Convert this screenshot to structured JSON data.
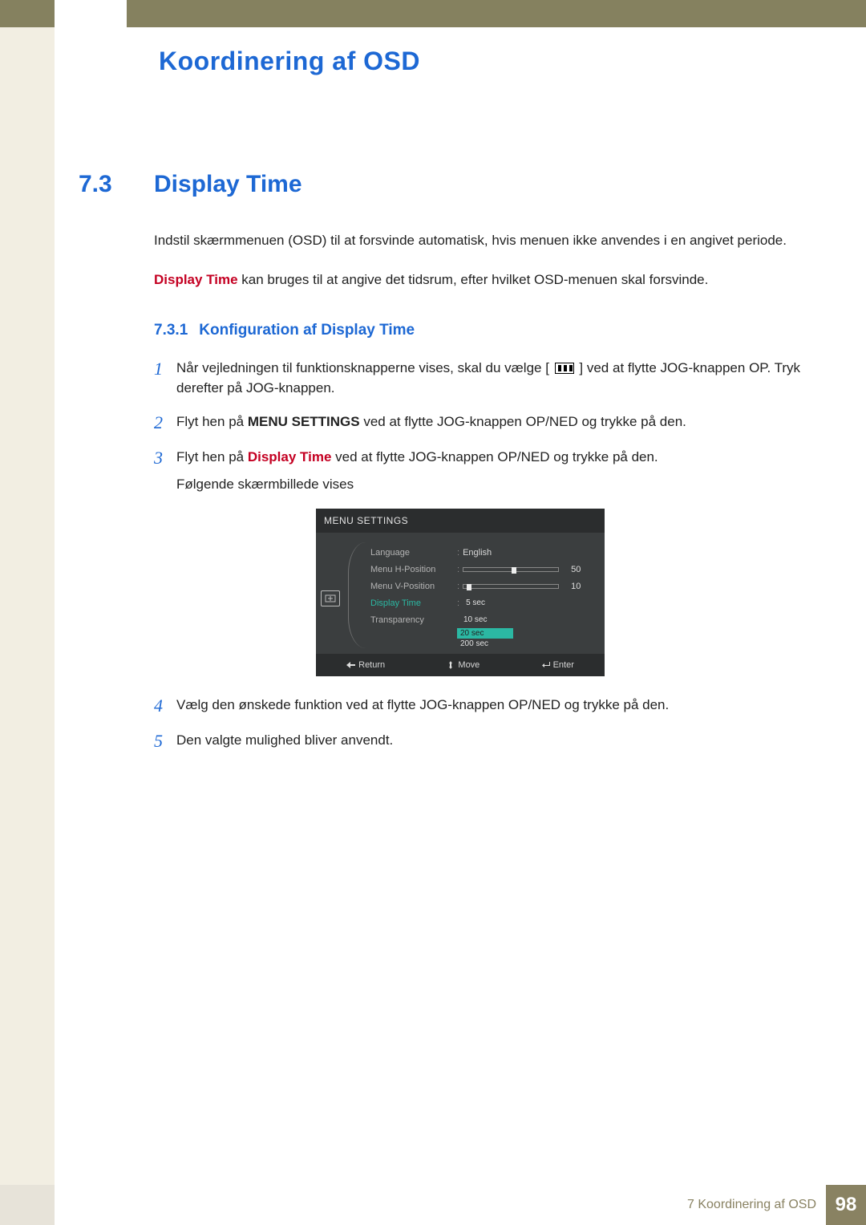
{
  "header": {
    "chapter_title": "Koordinering af OSD"
  },
  "section": {
    "number": "7.3",
    "title": "Display Time"
  },
  "intro": {
    "p1": "Indstil skærmmenuen (OSD) til at forsvinde automatisk, hvis menuen ikke anvendes i en angivet periode.",
    "p2_red": "Display Time",
    "p2_rest": " kan bruges til at angive det tidsrum, efter hvilket OSD-menuen skal forsvinde."
  },
  "subsection": {
    "number": "7.3.1",
    "title": "Konfiguration af Display Time"
  },
  "steps": {
    "s1_a": "Når vejledningen til funktionsknapperne vises, skal du vælge [",
    "s1_b": "] ved at flytte JOG-knappen OP. Tryk derefter på JOG-knappen.",
    "s2_a": "Flyt hen på ",
    "s2_bold": "MENU SETTINGS",
    "s2_b": " ved at flytte JOG-knappen OP/NED og trykke på den.",
    "s3_a": "Flyt hen på ",
    "s3_red": "Display Time",
    "s3_b": " ved at flytte JOG-knappen OP/NED og trykke på den.",
    "s3_sub": "Følgende skærmbillede vises",
    "s4": "Vælg den ønskede funktion ved at flytte JOG-knappen OP/NED og trykke på den.",
    "s5": "Den valgte mulighed bliver anvendt."
  },
  "nums": {
    "n1": "1",
    "n2": "2",
    "n3": "3",
    "n4": "4",
    "n5": "5"
  },
  "osd": {
    "title": "MENU SETTINGS",
    "rows": {
      "language": {
        "label": "Language",
        "value": "English"
      },
      "hpos": {
        "label": "Menu H-Position",
        "value": "50",
        "knob": 84
      },
      "vpos": {
        "label": "Menu V-Position",
        "value": "10",
        "knob": 6
      },
      "dtime": {
        "label": "Display Time"
      },
      "transp": {
        "label": "Transparency"
      }
    },
    "options": {
      "o1": "5 sec",
      "o2": "10 sec",
      "o3": "20 sec",
      "o4": "200 sec"
    },
    "footer": {
      "return": "Return",
      "move": "Move",
      "enter": "Enter"
    }
  },
  "footer": {
    "chapter": "7 Koordinering af OSD",
    "page": "98"
  }
}
